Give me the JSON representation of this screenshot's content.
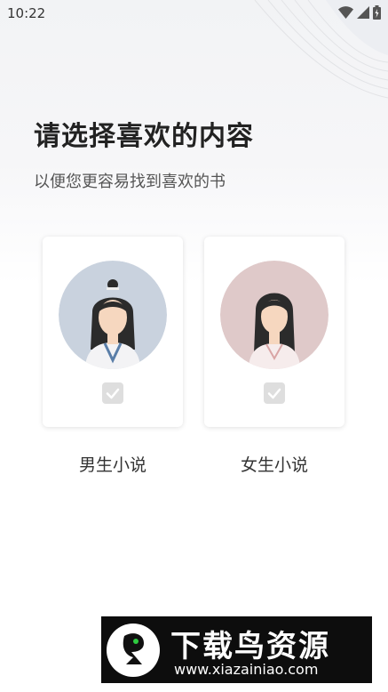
{
  "status_bar": {
    "time": "10:22",
    "icons": [
      "wifi-icon",
      "signal-icon",
      "battery-icon"
    ]
  },
  "header": {
    "title": "请选择喜欢的内容",
    "subtitle": "以便您更容易找到喜欢的书"
  },
  "options": [
    {
      "label": "男生小说",
      "avatar": "male-avatar-icon",
      "checked": false
    },
    {
      "label": "女生小说",
      "avatar": "female-avatar-icon",
      "checked": false
    }
  ],
  "watermark": {
    "title": "下载鸟资源",
    "url": "www.xiazainiao.com"
  },
  "colors": {
    "male_avatar_bg": "#c9d2de",
    "female_avatar_bg": "#dfc9c9",
    "check_bg": "#dedede"
  }
}
